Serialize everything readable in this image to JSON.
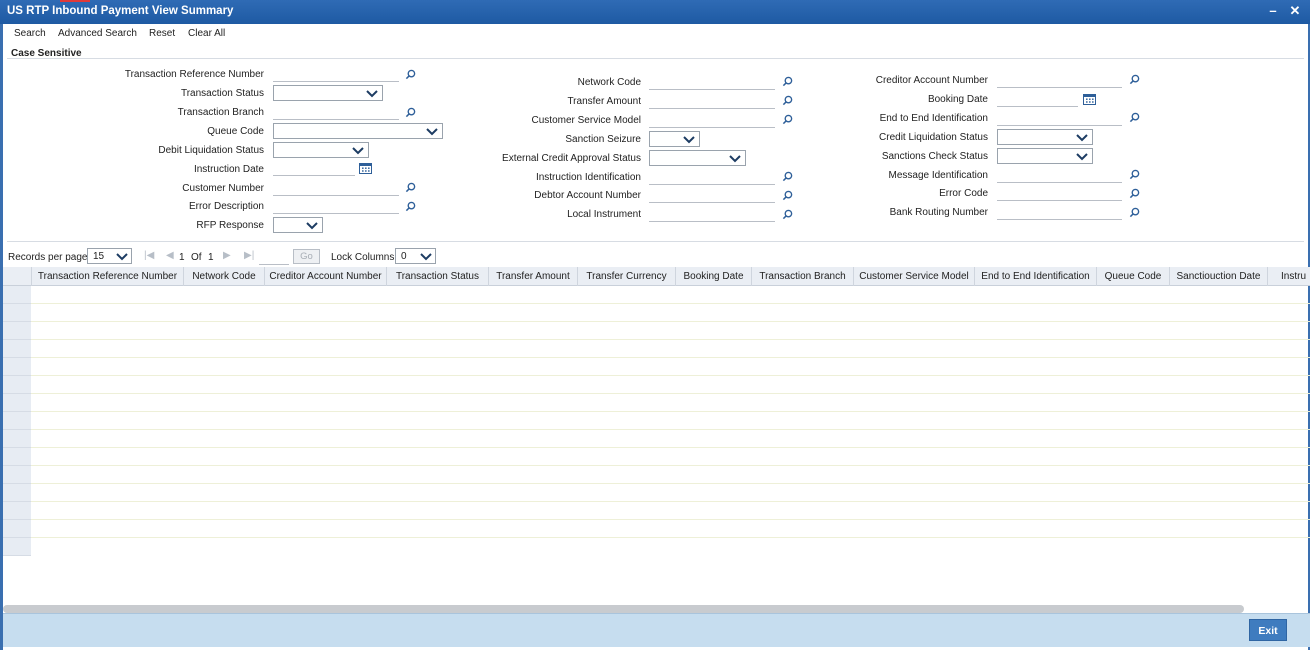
{
  "window": {
    "title": "US RTP Inbound Payment View Summary"
  },
  "toolbar": {
    "search": "Search",
    "advanced_search": "Advanced Search",
    "reset": "Reset",
    "clear_all": "Clear All"
  },
  "panel": {
    "case_sensitive": "Case Sensitive"
  },
  "fields": {
    "col1": {
      "transaction_reference_number": "Transaction Reference Number",
      "transaction_status": "Transaction Status",
      "transaction_branch": "Transaction Branch",
      "queue_code": "Queue Code",
      "debit_liquidation_status": "Debit Liquidation Status",
      "instruction_date": "Instruction Date",
      "customer_number": "Customer Number",
      "error_description": "Error Description",
      "rfp_response": "RFP Response"
    },
    "col2": {
      "network_code": "Network Code",
      "transfer_amount": "Transfer Amount",
      "customer_service_model": "Customer Service Model",
      "sanction_seizure": "Sanction Seizure",
      "external_credit_approval_status": "External Credit Approval Status",
      "instruction_identification": "Instruction Identification",
      "debtor_account_number": "Debtor Account Number",
      "local_instrument": "Local Instrument"
    },
    "col3": {
      "creditor_account_number": "Creditor Account Number",
      "booking_date": "Booking Date",
      "end_to_end_identification": "End to End Identification",
      "credit_liquidation_status": "Credit Liquidation Status",
      "sanctions_check_status": "Sanctions Check Status",
      "message_identification": "Message Identification",
      "error_code": "Error Code",
      "bank_routing_number": "Bank Routing Number"
    }
  },
  "pager": {
    "records_per_page_label": "Records per page",
    "records_per_page": "15",
    "page": "1",
    "of": "Of",
    "total_pages": "1",
    "go": "Go",
    "lock_columns_label": "Lock Columns",
    "lock_columns": "0"
  },
  "grid": {
    "columns": [
      "Transaction Reference Number",
      "Network Code",
      "Creditor Account Number",
      "Transaction Status",
      "Transfer Amount",
      "Transfer Currency",
      "Booking Date",
      "Transaction Branch",
      "Customer Service Model",
      "End to End Identification",
      "Queue Code",
      "Sanctiouction Date",
      "Instru"
    ]
  },
  "footer": {
    "exit": "Exit"
  },
  "colors": {
    "titlebar": "#1e5aa3",
    "footer": "#c6ddef",
    "exit": "#3f7cbf"
  }
}
